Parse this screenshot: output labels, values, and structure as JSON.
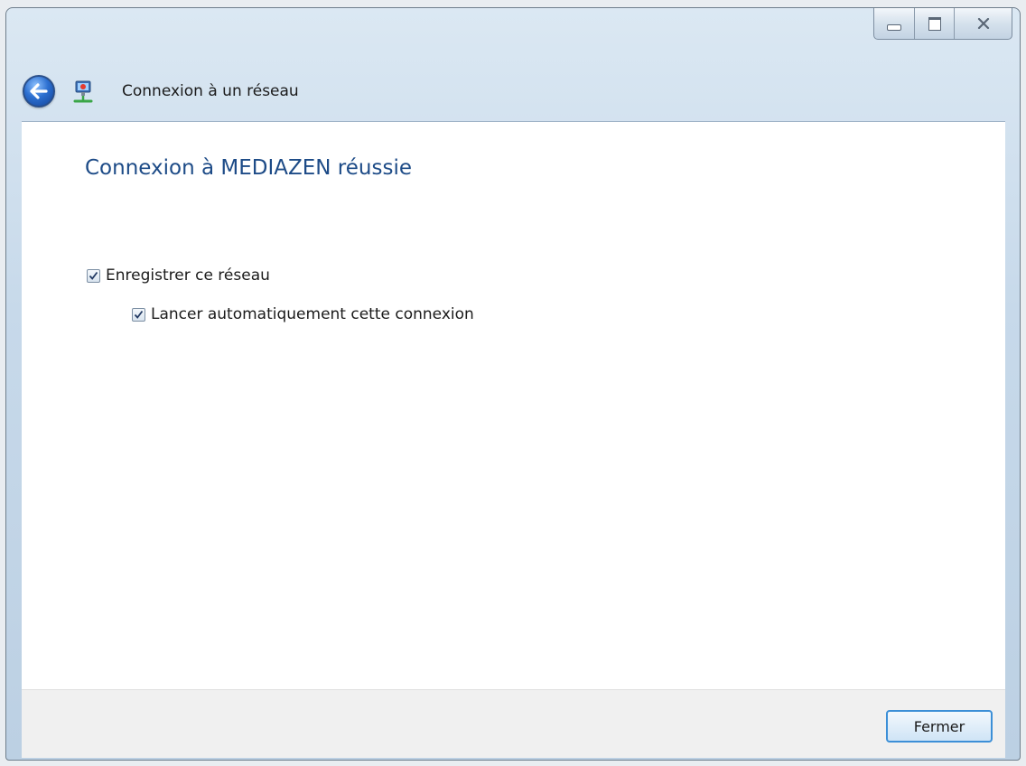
{
  "window": {
    "title": "Connexion à un réseau",
    "caption_buttons": {
      "minimize_icon": "minimize-icon",
      "maximize_icon": "maximize-icon",
      "close_icon": "close-icon",
      "close_glyph": "☒"
    }
  },
  "main": {
    "heading": "Connexion à MEDIAZEN réussie",
    "options": [
      {
        "label": "Enregistrer ce réseau",
        "checked": true
      },
      {
        "label": "Lancer automatiquement cette connexion",
        "checked": true
      }
    ]
  },
  "footer": {
    "close_label": "Fermer"
  },
  "colors": {
    "heading": "#1d4b87",
    "default_button_border": "#3c8fd7"
  }
}
